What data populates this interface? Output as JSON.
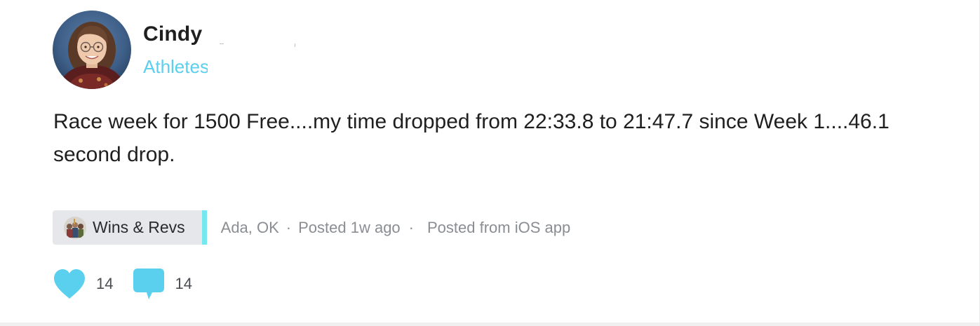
{
  "author": {
    "name": "Cindy",
    "role": "Athletes"
  },
  "post": {
    "body": "Race week for 1500 Free....my time dropped from 22:33.8 to 21:47.7 since Week 1....46.1 second drop."
  },
  "meta": {
    "category": "Wins & Revs",
    "location": "Ada, OK",
    "separator": "·",
    "posted": "Posted 1w ago",
    "source": "Posted from iOS app"
  },
  "actions": {
    "likes": "14",
    "comments": "14"
  },
  "colors": {
    "accent": "#5bcfee",
    "tag_bg": "#e6e7eb",
    "tag_stripe": "#74e7ef",
    "text": "#1f1f1f",
    "muted": "#8a8d92"
  },
  "icons": {
    "like": "heart-icon",
    "comment": "speech-bubble-icon",
    "category": "category-badge-icon"
  }
}
